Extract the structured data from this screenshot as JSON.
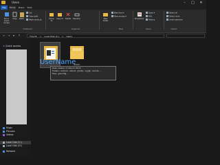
{
  "window": {
    "title": "Users",
    "controls": {
      "minimize": "–",
      "maximize": "□",
      "close": "✕"
    }
  },
  "ribbon_tabs": [
    "File",
    "Home",
    "Share",
    "View"
  ],
  "ribbon": {
    "pin_label": "Pin to Quick access",
    "copy_label": "Copy",
    "paste_label": "Paste",
    "cut_label": "Cut",
    "copy_path_label": "Copy path",
    "paste_shortcut_label": "Paste shortcut",
    "move_to_label": "Move to",
    "copy_to_label": "Copy to",
    "delete_label": "Delete",
    "rename_label": "Rename",
    "new_folder_label": "New folder",
    "new_item_label": "New item ▾",
    "easy_access_label": "Easy access ▾",
    "properties_label": "Properties",
    "open_label": "Open ▾",
    "edit_label": "Edit",
    "history_label": "History",
    "select_all_label": "Select all",
    "select_none_label": "Select none",
    "invert_selection_label": "Invert selection",
    "groups": {
      "clipboard": "Clipboard",
      "organize": "Organize",
      "new": "New",
      "open": "Open",
      "select": "Select"
    }
  },
  "address": {
    "crumbs": [
      "This PC",
      ">",
      "Local Disk (C:)",
      ">",
      "Users"
    ]
  },
  "nav": {
    "quick_access": "Quick access",
    "items": [
      {
        "label": "Music",
        "color": "#4f8fe6"
      },
      {
        "label": "Pictures",
        "color": "#4f8fe6"
      },
      {
        "label": "Videos",
        "color": "#9b59d6"
      },
      {
        "label": "Local Disk (C:)",
        "color": "#9ab0c4",
        "selected": true
      },
      {
        "label": "Local Disk (D:)",
        "color": "#9ab0c4"
      },
      {
        "label": "Network",
        "color": "#4f8fe6"
      }
    ]
  },
  "content": {
    "folders": [
      {
        "name": "UserName",
        "selected": true
      },
      {
        "name": "Public",
        "selected": false
      }
    ],
    "tooltip": {
      "line1": "Date created: 27-Mar-21 09:53",
      "line2": "Folders: .android, .dotnet, .gradle, .nuget, .vscode, ...",
      "line3": "Files: .gitconfig, ..."
    }
  },
  "colors": {
    "accent": "#1a5fb4",
    "username_text": "#4ca3ff",
    "folder": "#e8b84a",
    "redaction": "#c9c9c9"
  }
}
